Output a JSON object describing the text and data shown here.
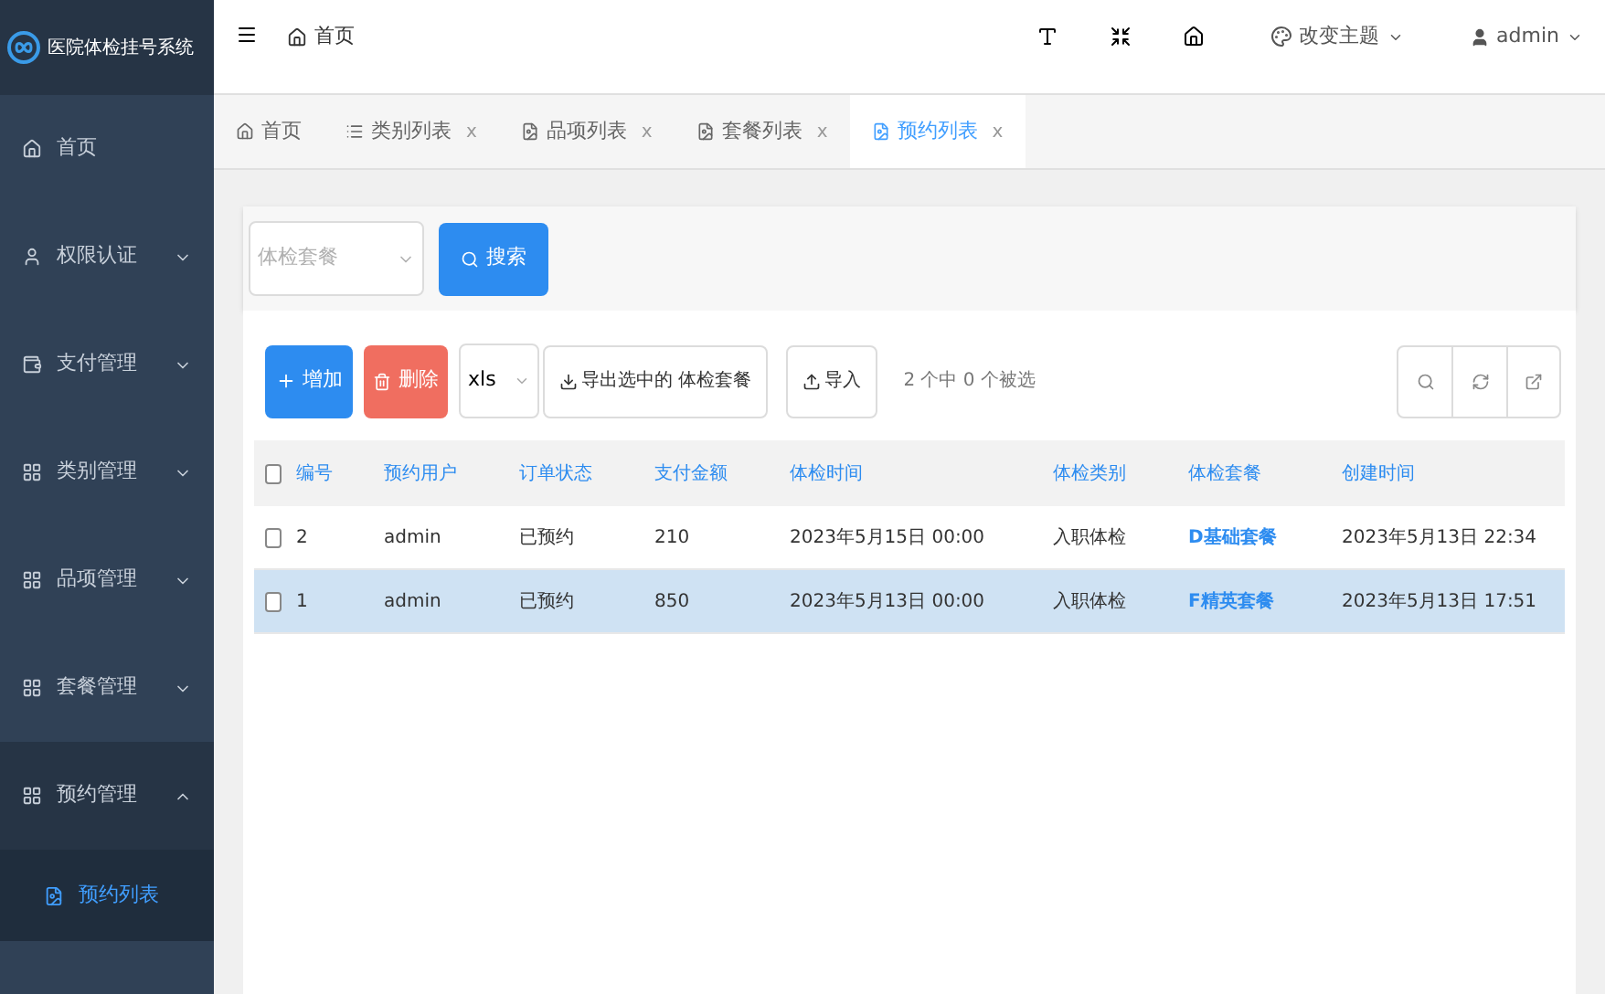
{
  "app": {
    "title": "医院体检挂号系统"
  },
  "header": {
    "breadcrumb": "首页",
    "theme": "改变主题",
    "user": "admin"
  },
  "sidebar": {
    "items": [
      {
        "label": "首页"
      },
      {
        "label": "权限认证",
        "expanded": false
      },
      {
        "label": "支付管理",
        "expanded": false
      },
      {
        "label": "类别管理",
        "expanded": false
      },
      {
        "label": "品项管理",
        "expanded": false
      },
      {
        "label": "套餐管理",
        "expanded": false
      },
      {
        "label": "预约管理",
        "expanded": true,
        "children": [
          {
            "label": "预约列表",
            "selected": true
          }
        ]
      }
    ]
  },
  "tabs": [
    {
      "label": "首页",
      "selected": false
    },
    {
      "label": "类别列表",
      "close": "x",
      "selected": false
    },
    {
      "label": "品项列表",
      "close": "x",
      "selected": false
    },
    {
      "label": "套餐列表",
      "close": "x",
      "selected": false
    },
    {
      "label": "预约列表",
      "close": "x",
      "selected": true
    }
  ],
  "search": {
    "placeholder": "体检套餐",
    "button": "搜索"
  },
  "toolbar": {
    "add": "增加",
    "delete": "删除",
    "format": "xls",
    "export": "导出选中的 体检套餐",
    "import": "导入",
    "selection": "2 个中 0 个被选"
  },
  "table": {
    "all_checked": false,
    "columns": [
      "编号",
      "预约用户",
      "订单状态",
      "支付金额",
      "体检时间",
      "体检类别",
      "体检套餐",
      "创建时间"
    ],
    "rows": [
      {
        "selected": false,
        "checked": false,
        "cells": [
          "2",
          "admin",
          "已预约",
          "210",
          "2023年5月15日 00:00",
          "入职体检",
          "D基础套餐",
          "2023年5月13日 22:34"
        ]
      },
      {
        "selected": true,
        "checked": false,
        "cells": [
          "1",
          "admin",
          "已预约",
          "850",
          "2023年5月13日 00:00",
          "入职体检",
          "F精英套餐",
          "2023年5月13日 17:51"
        ]
      }
    ]
  }
}
